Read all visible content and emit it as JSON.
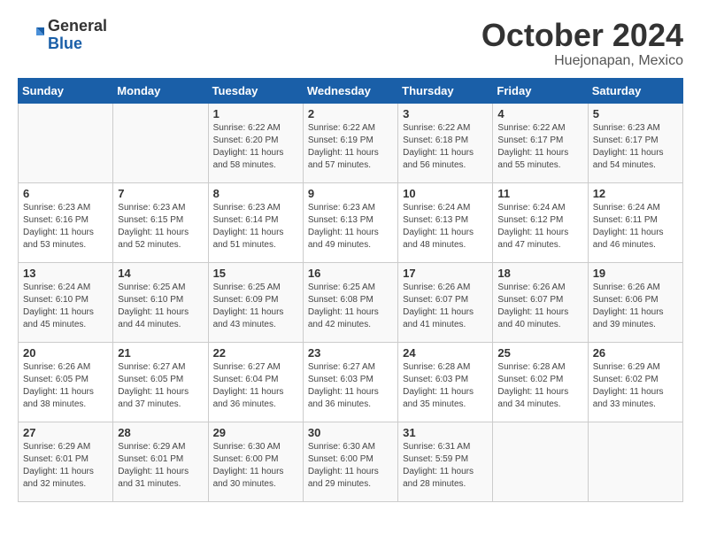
{
  "header": {
    "logo_line1": "General",
    "logo_line2": "Blue",
    "month": "October 2024",
    "location": "Huejonapan, Mexico"
  },
  "weekdays": [
    "Sunday",
    "Monday",
    "Tuesday",
    "Wednesday",
    "Thursday",
    "Friday",
    "Saturday"
  ],
  "weeks": [
    [
      {
        "day": "",
        "info": ""
      },
      {
        "day": "",
        "info": ""
      },
      {
        "day": "1",
        "info": "Sunrise: 6:22 AM\nSunset: 6:20 PM\nDaylight: 11 hours\nand 58 minutes."
      },
      {
        "day": "2",
        "info": "Sunrise: 6:22 AM\nSunset: 6:19 PM\nDaylight: 11 hours\nand 57 minutes."
      },
      {
        "day": "3",
        "info": "Sunrise: 6:22 AM\nSunset: 6:18 PM\nDaylight: 11 hours\nand 56 minutes."
      },
      {
        "day": "4",
        "info": "Sunrise: 6:22 AM\nSunset: 6:17 PM\nDaylight: 11 hours\nand 55 minutes."
      },
      {
        "day": "5",
        "info": "Sunrise: 6:23 AM\nSunset: 6:17 PM\nDaylight: 11 hours\nand 54 minutes."
      }
    ],
    [
      {
        "day": "6",
        "info": "Sunrise: 6:23 AM\nSunset: 6:16 PM\nDaylight: 11 hours\nand 53 minutes."
      },
      {
        "day": "7",
        "info": "Sunrise: 6:23 AM\nSunset: 6:15 PM\nDaylight: 11 hours\nand 52 minutes."
      },
      {
        "day": "8",
        "info": "Sunrise: 6:23 AM\nSunset: 6:14 PM\nDaylight: 11 hours\nand 51 minutes."
      },
      {
        "day": "9",
        "info": "Sunrise: 6:23 AM\nSunset: 6:13 PM\nDaylight: 11 hours\nand 49 minutes."
      },
      {
        "day": "10",
        "info": "Sunrise: 6:24 AM\nSunset: 6:13 PM\nDaylight: 11 hours\nand 48 minutes."
      },
      {
        "day": "11",
        "info": "Sunrise: 6:24 AM\nSunset: 6:12 PM\nDaylight: 11 hours\nand 47 minutes."
      },
      {
        "day": "12",
        "info": "Sunrise: 6:24 AM\nSunset: 6:11 PM\nDaylight: 11 hours\nand 46 minutes."
      }
    ],
    [
      {
        "day": "13",
        "info": "Sunrise: 6:24 AM\nSunset: 6:10 PM\nDaylight: 11 hours\nand 45 minutes."
      },
      {
        "day": "14",
        "info": "Sunrise: 6:25 AM\nSunset: 6:10 PM\nDaylight: 11 hours\nand 44 minutes."
      },
      {
        "day": "15",
        "info": "Sunrise: 6:25 AM\nSunset: 6:09 PM\nDaylight: 11 hours\nand 43 minutes."
      },
      {
        "day": "16",
        "info": "Sunrise: 6:25 AM\nSunset: 6:08 PM\nDaylight: 11 hours\nand 42 minutes."
      },
      {
        "day": "17",
        "info": "Sunrise: 6:26 AM\nSunset: 6:07 PM\nDaylight: 11 hours\nand 41 minutes."
      },
      {
        "day": "18",
        "info": "Sunrise: 6:26 AM\nSunset: 6:07 PM\nDaylight: 11 hours\nand 40 minutes."
      },
      {
        "day": "19",
        "info": "Sunrise: 6:26 AM\nSunset: 6:06 PM\nDaylight: 11 hours\nand 39 minutes."
      }
    ],
    [
      {
        "day": "20",
        "info": "Sunrise: 6:26 AM\nSunset: 6:05 PM\nDaylight: 11 hours\nand 38 minutes."
      },
      {
        "day": "21",
        "info": "Sunrise: 6:27 AM\nSunset: 6:05 PM\nDaylight: 11 hours\nand 37 minutes."
      },
      {
        "day": "22",
        "info": "Sunrise: 6:27 AM\nSunset: 6:04 PM\nDaylight: 11 hours\nand 36 minutes."
      },
      {
        "day": "23",
        "info": "Sunrise: 6:27 AM\nSunset: 6:03 PM\nDaylight: 11 hours\nand 36 minutes."
      },
      {
        "day": "24",
        "info": "Sunrise: 6:28 AM\nSunset: 6:03 PM\nDaylight: 11 hours\nand 35 minutes."
      },
      {
        "day": "25",
        "info": "Sunrise: 6:28 AM\nSunset: 6:02 PM\nDaylight: 11 hours\nand 34 minutes."
      },
      {
        "day": "26",
        "info": "Sunrise: 6:29 AM\nSunset: 6:02 PM\nDaylight: 11 hours\nand 33 minutes."
      }
    ],
    [
      {
        "day": "27",
        "info": "Sunrise: 6:29 AM\nSunset: 6:01 PM\nDaylight: 11 hours\nand 32 minutes."
      },
      {
        "day": "28",
        "info": "Sunrise: 6:29 AM\nSunset: 6:01 PM\nDaylight: 11 hours\nand 31 minutes."
      },
      {
        "day": "29",
        "info": "Sunrise: 6:30 AM\nSunset: 6:00 PM\nDaylight: 11 hours\nand 30 minutes."
      },
      {
        "day": "30",
        "info": "Sunrise: 6:30 AM\nSunset: 6:00 PM\nDaylight: 11 hours\nand 29 minutes."
      },
      {
        "day": "31",
        "info": "Sunrise: 6:31 AM\nSunset: 5:59 PM\nDaylight: 11 hours\nand 28 minutes."
      },
      {
        "day": "",
        "info": ""
      },
      {
        "day": "",
        "info": ""
      }
    ]
  ]
}
